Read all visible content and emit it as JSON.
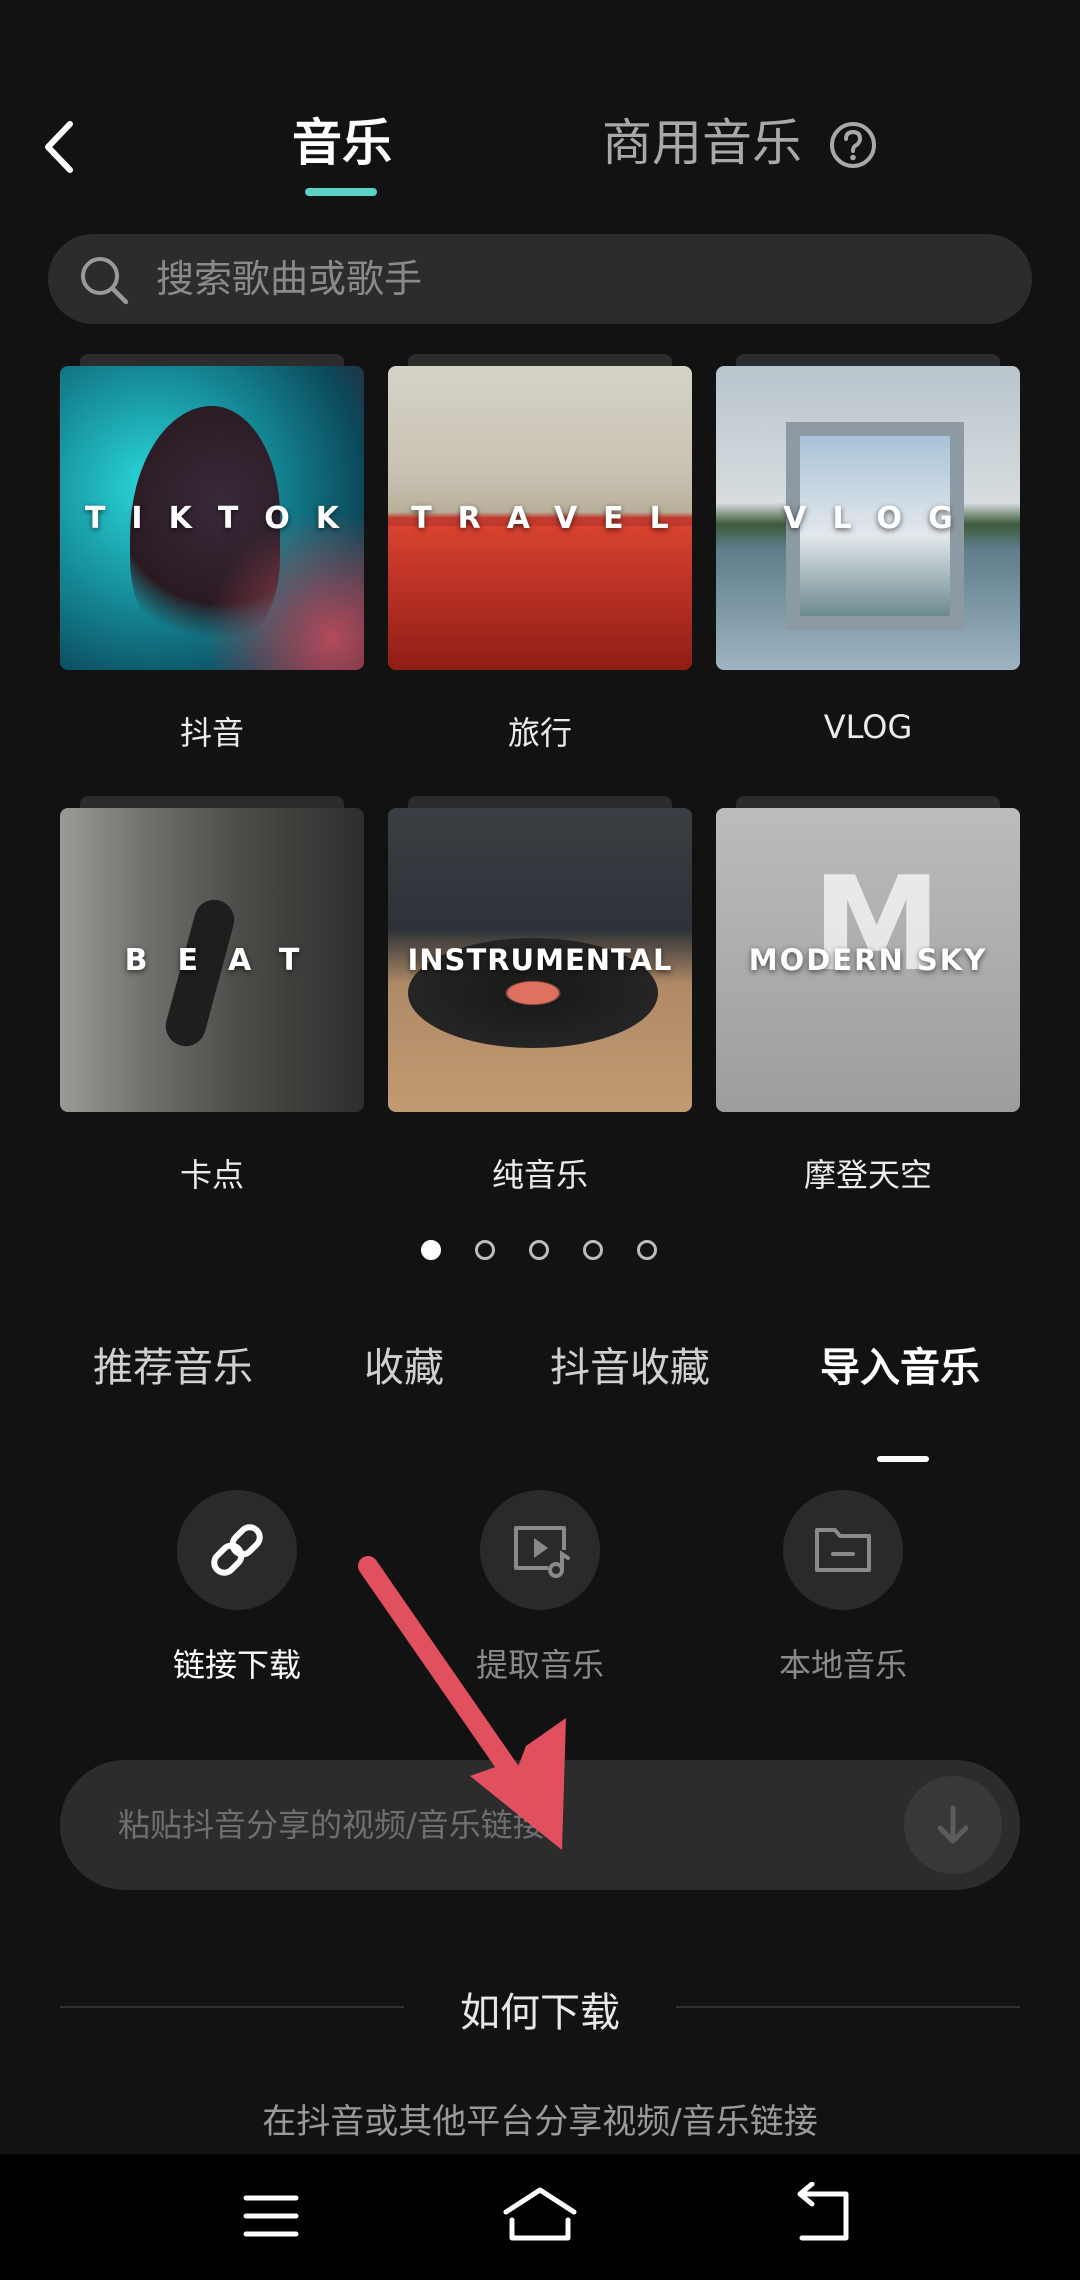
{
  "header": {
    "tab_music": "音乐",
    "tab_commercial": "商用音乐",
    "accent_color": "#5ad4c6"
  },
  "search": {
    "placeholder": "搜索歌曲或歌手"
  },
  "playlists": [
    {
      "cover_text": "TIKTOK",
      "title": "抖音"
    },
    {
      "cover_text": "TRAVEL",
      "title": "旅行"
    },
    {
      "cover_text": "VLOG",
      "title": "VLOG"
    },
    {
      "cover_text": "BEAT",
      "title": "卡点"
    },
    {
      "cover_text": "INSTRUMENTAL",
      "title": "纯音乐"
    },
    {
      "cover_text": "MODERN SKY",
      "title": "摩登天空"
    }
  ],
  "pager": {
    "total": 5,
    "current": 1
  },
  "sections": {
    "tabs": [
      "推荐音乐",
      "收藏",
      "抖音收藏",
      "导入音乐"
    ],
    "active": "导入音乐"
  },
  "import_actions": [
    {
      "label": "链接下载",
      "icon": "link-icon",
      "active": true
    },
    {
      "label": "提取音乐",
      "icon": "video-music-icon",
      "active": false
    },
    {
      "label": "本地音乐",
      "icon": "folder-icon",
      "active": false
    }
  ],
  "link_input": {
    "placeholder": "粘贴抖音分享的视频/音乐链接"
  },
  "annotation": {
    "color": "#e0505e"
  },
  "howto": {
    "title": "如何下载",
    "description": "在抖音或其他平台分享视频/音乐链接"
  }
}
